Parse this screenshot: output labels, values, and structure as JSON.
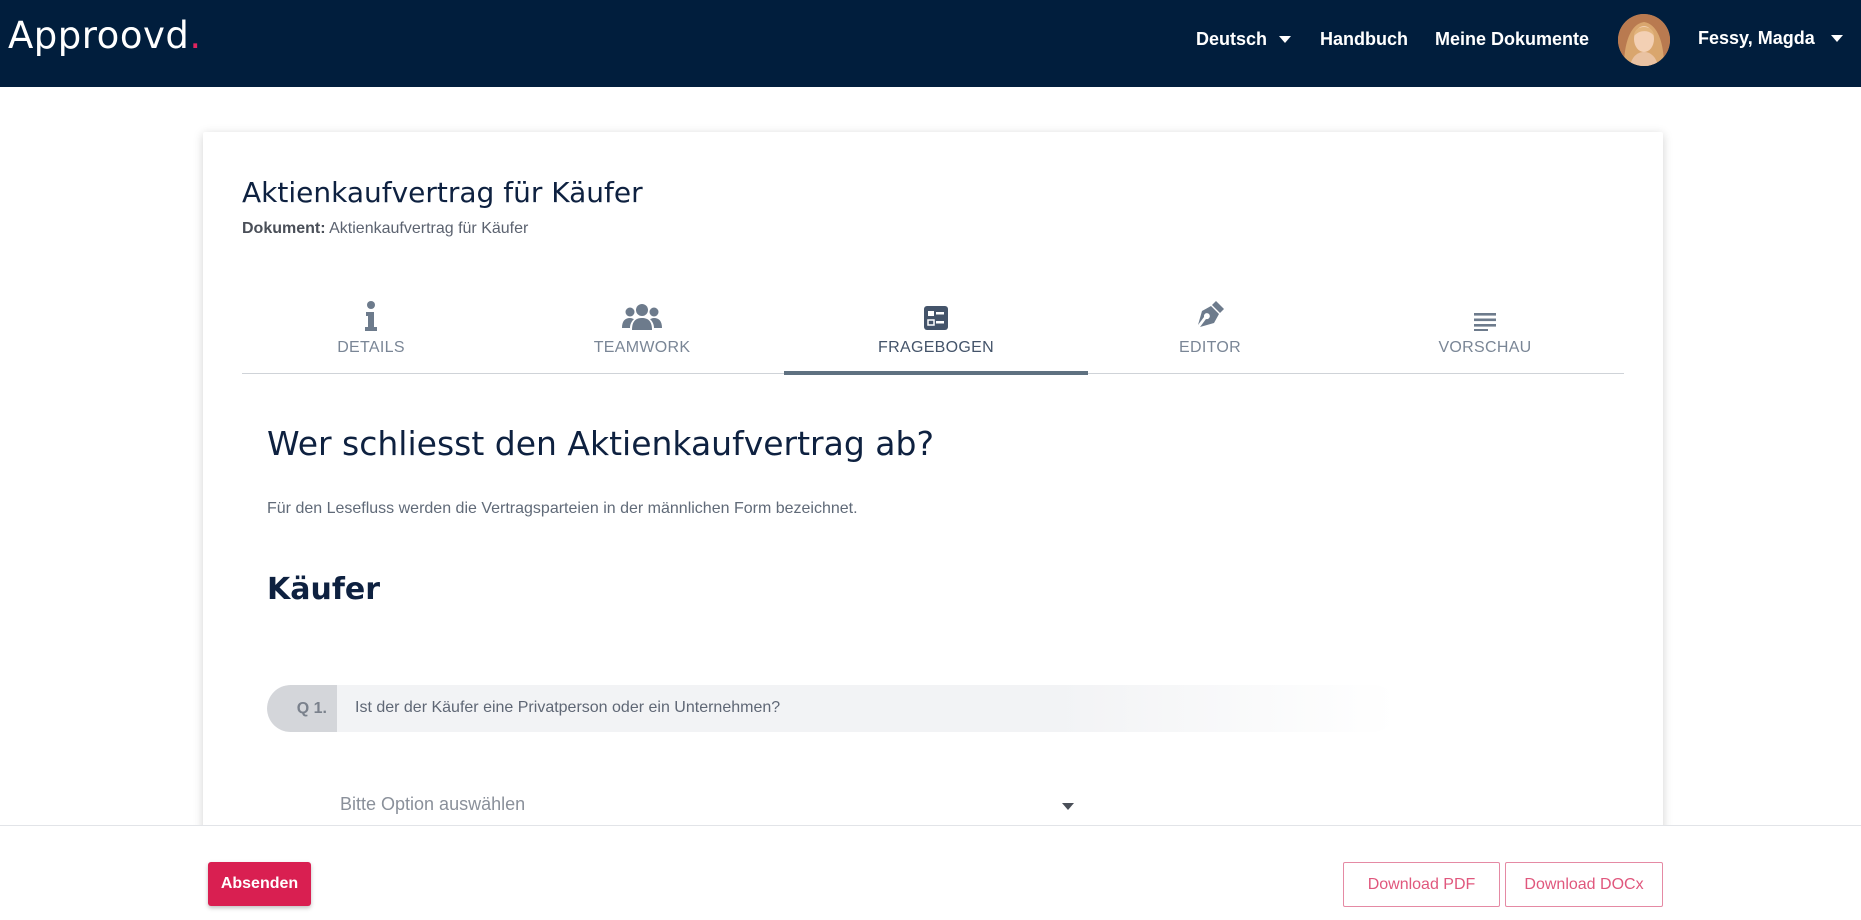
{
  "header": {
    "logo_text": "Approovd",
    "logo_dot": ".",
    "language": "Deutsch",
    "handbook": "Handbuch",
    "my_documents": "Meine Dokumente",
    "user_name": "Fessy, Magda"
  },
  "document": {
    "title": "Aktienkaufvertrag für Käufer",
    "sub_label": "Dokument:",
    "sub_value": "Aktienkaufvertrag für Käufer"
  },
  "tabs": [
    {
      "label": "DETAILS",
      "icon": "info-icon",
      "active": false
    },
    {
      "label": "TEAMWORK",
      "icon": "users-icon",
      "active": false
    },
    {
      "label": "FRAGEBOGEN",
      "icon": "questionnaire-icon",
      "active": true
    },
    {
      "label": "EDITOR",
      "icon": "pen-icon",
      "active": false
    },
    {
      "label": "VORSCHAU",
      "icon": "preview-icon",
      "active": false
    }
  ],
  "questionnaire": {
    "heading": "Wer schliesst den Aktienkaufvertrag ab?",
    "note": "Für den Lesefluss werden die Vertragsparteien in der männlichen Form bezeichnet.",
    "section": "Käufer",
    "question_number": "Q 1.",
    "question_text": "Ist der der Käufer eine Privatperson oder ein Unternehmen?",
    "select_placeholder": "Bitte Option auswählen"
  },
  "footer": {
    "submit": "Absenden",
    "download_pdf": "Download PDF",
    "download_docx": "Download DOCx"
  },
  "colors": {
    "topbar": "#011e3d",
    "accent": "#d91f51",
    "logo_dot": "#e0245e"
  }
}
